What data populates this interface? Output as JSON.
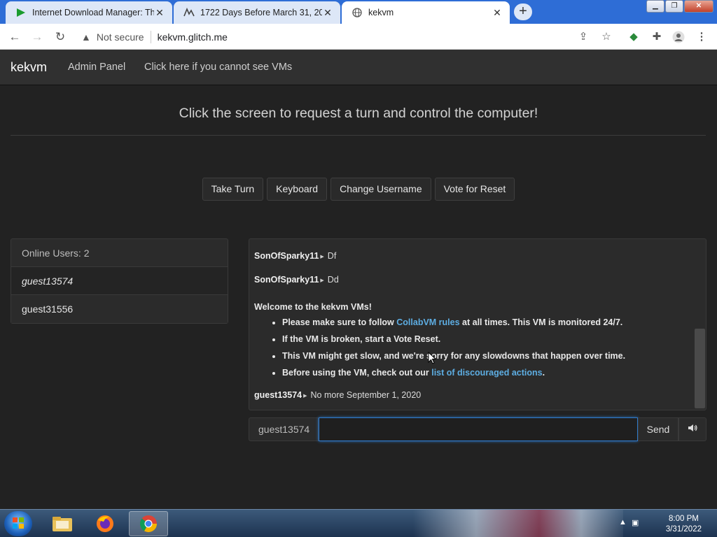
{
  "browser": {
    "tabs": [
      {
        "title": "Internet Download Manager: The",
        "active": false
      },
      {
        "title": "1722 Days Before March 31, 202",
        "active": false
      },
      {
        "title": "kekvm",
        "active": true
      }
    ],
    "new_tab_label": "+",
    "address": {
      "security_label": "Not secure",
      "url": "kekvm.glitch.me"
    }
  },
  "navbar": {
    "brand": "kekvm",
    "links": [
      "Admin Panel",
      "Click here if you cannot see VMs"
    ]
  },
  "main": {
    "headline": "Click the screen to request a turn and control the computer!",
    "buttons": [
      "Take Turn",
      "Keyboard",
      "Change Username",
      "Vote for Reset"
    ]
  },
  "users_panel": {
    "header": "Online Users: 2",
    "users": [
      "guest13574",
      "guest31556"
    ]
  },
  "chat": {
    "messages": [
      {
        "user": "SonOfSparky11",
        "text": "Df"
      },
      {
        "user": "SonOfSparky11",
        "text": "Dd"
      }
    ],
    "welcome": {
      "title": "Welcome to the kekvm VMs!",
      "items": [
        {
          "pre": "Please make sure to follow ",
          "link": "CollabVM rules",
          "post": " at all times. This VM is monitored 24/7."
        },
        {
          "pre": "If the VM is broken, start a Vote Reset.",
          "link": "",
          "post": ""
        },
        {
          "pre": "This VM might get slow, and we're sorry for any slowdowns that happen over time.",
          "link": "",
          "post": ""
        },
        {
          "pre": "Before using the VM, check out our ",
          "link": "list of discouraged actions",
          "post": "."
        }
      ]
    },
    "last_message": {
      "user": "guest13574",
      "text": "No more September 1, 2020"
    },
    "input": {
      "nickname": "guest13574",
      "value": "",
      "send_label": "Send",
      "volume_icon": "speaker-icon"
    }
  },
  "taskbar": {
    "clock_time": "8:00 PM",
    "clock_date": "3/31/2022"
  }
}
